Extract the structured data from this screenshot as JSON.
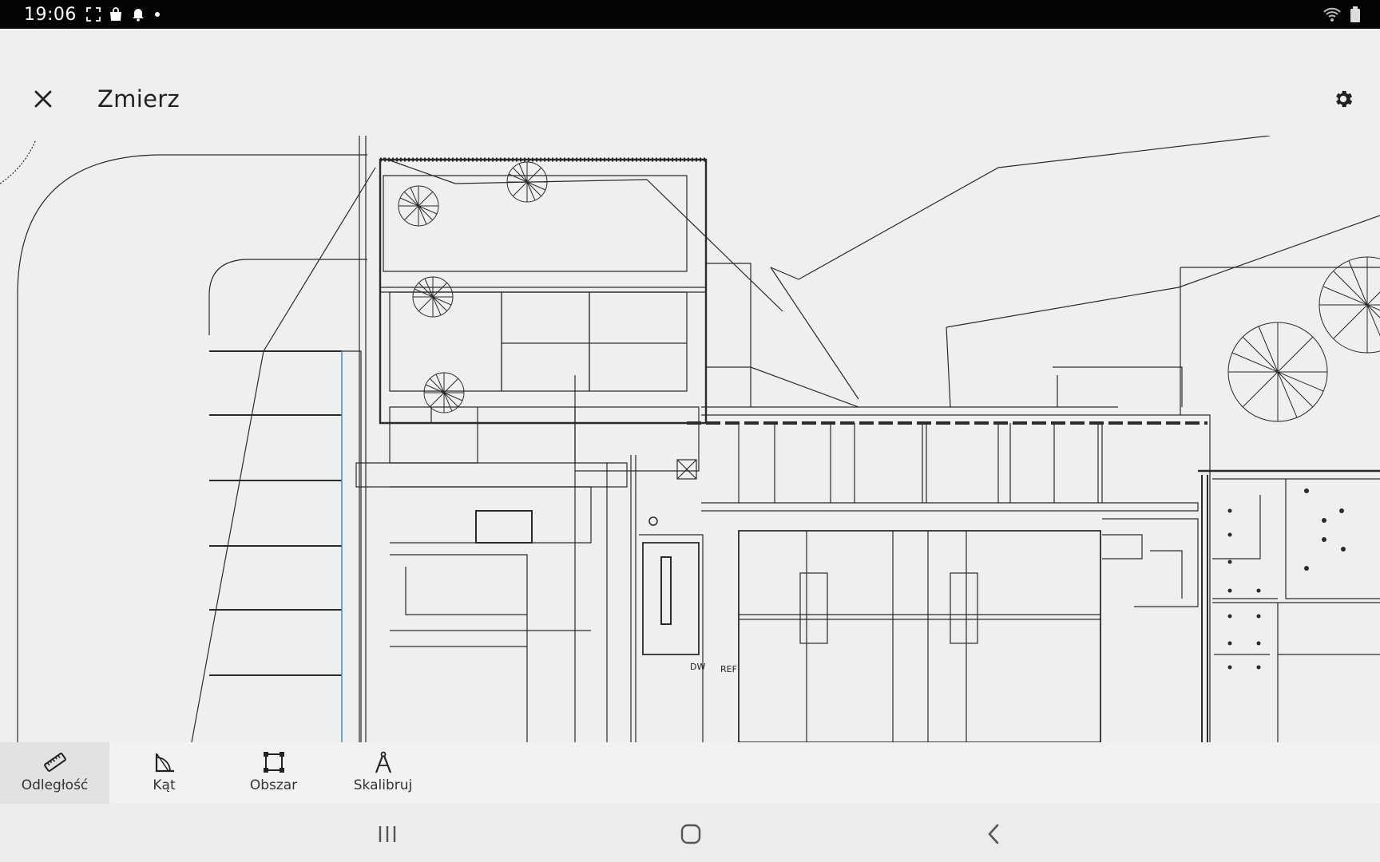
{
  "status_bar": {
    "time": "19:06",
    "left_icons": [
      "screenshot-icon",
      "shopping-bag-icon",
      "bell-icon",
      "dot-icon"
    ],
    "right_icons": [
      "wifi-icon",
      "battery-icon"
    ]
  },
  "app_bar": {
    "title": "Zmierz",
    "close_icon": "close-icon",
    "settings_icon": "gear-icon"
  },
  "toolbar": {
    "tools": [
      {
        "label": "Odległość",
        "icon": "ruler-icon",
        "active": true
      },
      {
        "label": "Kąt",
        "icon": "angle-icon",
        "active": false
      },
      {
        "label": "Obszar",
        "icon": "area-icon",
        "active": false
      },
      {
        "label": "Skalibruj",
        "icon": "calibrate-icon",
        "active": false
      }
    ]
  },
  "drawing": {
    "labels": [
      "DW",
      "REF"
    ],
    "line_color": "#2a2a2a",
    "accent_color": "#3b9bd8"
  },
  "nav_bar": {
    "buttons": [
      "recent-apps-icon",
      "home-icon",
      "back-icon"
    ]
  }
}
